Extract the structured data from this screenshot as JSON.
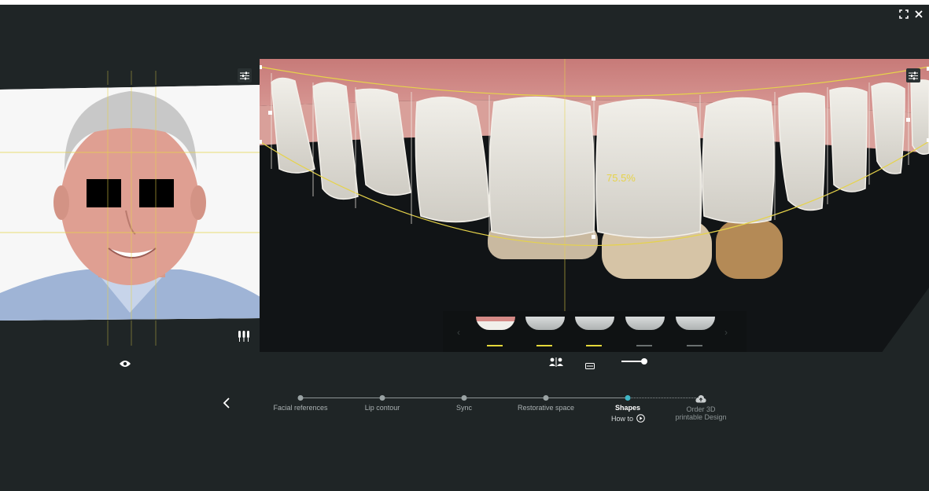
{
  "window": {
    "fullscreen_icon": "fullscreen-icon",
    "close_icon": "close-icon"
  },
  "measurement": {
    "ratio": "75.5%"
  },
  "steps": [
    {
      "label": "Facial references",
      "active": false
    },
    {
      "label": "Lip contour",
      "active": false
    },
    {
      "label": "Sync",
      "active": false
    },
    {
      "label": "Restorative space",
      "active": false
    },
    {
      "label": "Shapes",
      "active": true,
      "sub": "How to"
    },
    {
      "label": "Order 3D printable Design",
      "active": false,
      "icon": "cloud-upload-icon"
    }
  ],
  "thumbnails": [
    {
      "active_indicator": "#e4d83a"
    },
    {
      "active_indicator": "#e4d83a"
    },
    {
      "active_indicator": "#e4d83a"
    },
    {
      "active_indicator": "#6a7070"
    },
    {
      "active_indicator": "#6a7070"
    }
  ],
  "colors": {
    "guide": "#e6d34a",
    "accent": "#3fb6c6",
    "background": "#1f2526"
  }
}
